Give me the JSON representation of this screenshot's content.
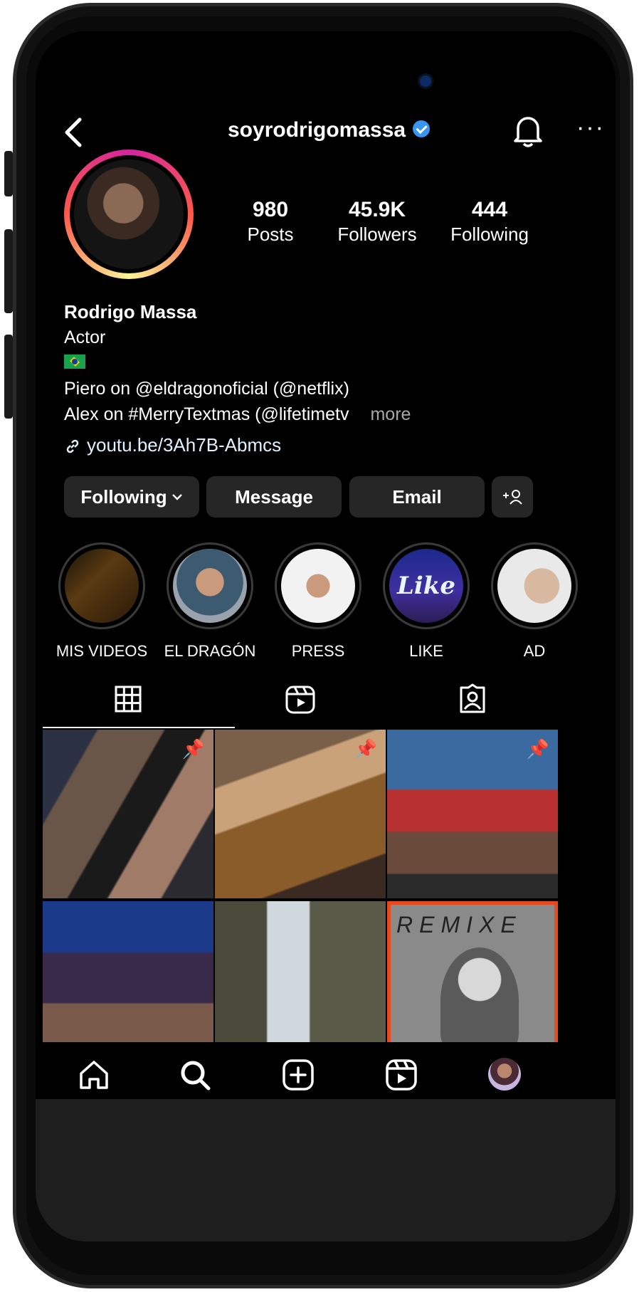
{
  "profile": {
    "username": "soyrodrigomassa",
    "verified": true,
    "stats": {
      "posts": {
        "value": "980",
        "label": "Posts"
      },
      "followers": {
        "value": "45.9K",
        "label": "Followers"
      },
      "following": {
        "value": "444",
        "label": "Following"
      }
    },
    "display_name": "Rodrigo Massa",
    "category": "Actor",
    "bio_line1": "Piero on @eldragonoficial (@netflix)",
    "bio_line2": "Alex on #MerryTextmas (@lifetimetv",
    "more_label": "more",
    "link": "youtu.be/3Ah7B-Abmcs"
  },
  "actions": {
    "following_label": "Following",
    "message_label": "Message",
    "email_label": "Email"
  },
  "highlights": [
    {
      "label": "MIS VIDEOS"
    },
    {
      "label": "EL DRAGÓN"
    },
    {
      "label": "PRESS"
    },
    {
      "label": "LIKE"
    },
    {
      "label": "AD"
    }
  ],
  "highlight_like_text": "Like",
  "grid_remix_text": "REMIXE",
  "icons": {
    "back": "back-arrow-icon",
    "bell": "bell-icon",
    "more": "more-dots-icon",
    "grid_tab": "grid-icon",
    "reels_tab": "reels-icon",
    "tagged_tab": "tagged-icon",
    "home": "home-icon",
    "search": "search-icon",
    "create": "create-post-icon",
    "reels_nav": "reels-nav-icon",
    "profile_nav": "profile-avatar-icon"
  },
  "colors": {
    "background": "#000000",
    "button": "#262626",
    "verified": "#3797f0",
    "secondary_text": "#a8a8a8"
  }
}
